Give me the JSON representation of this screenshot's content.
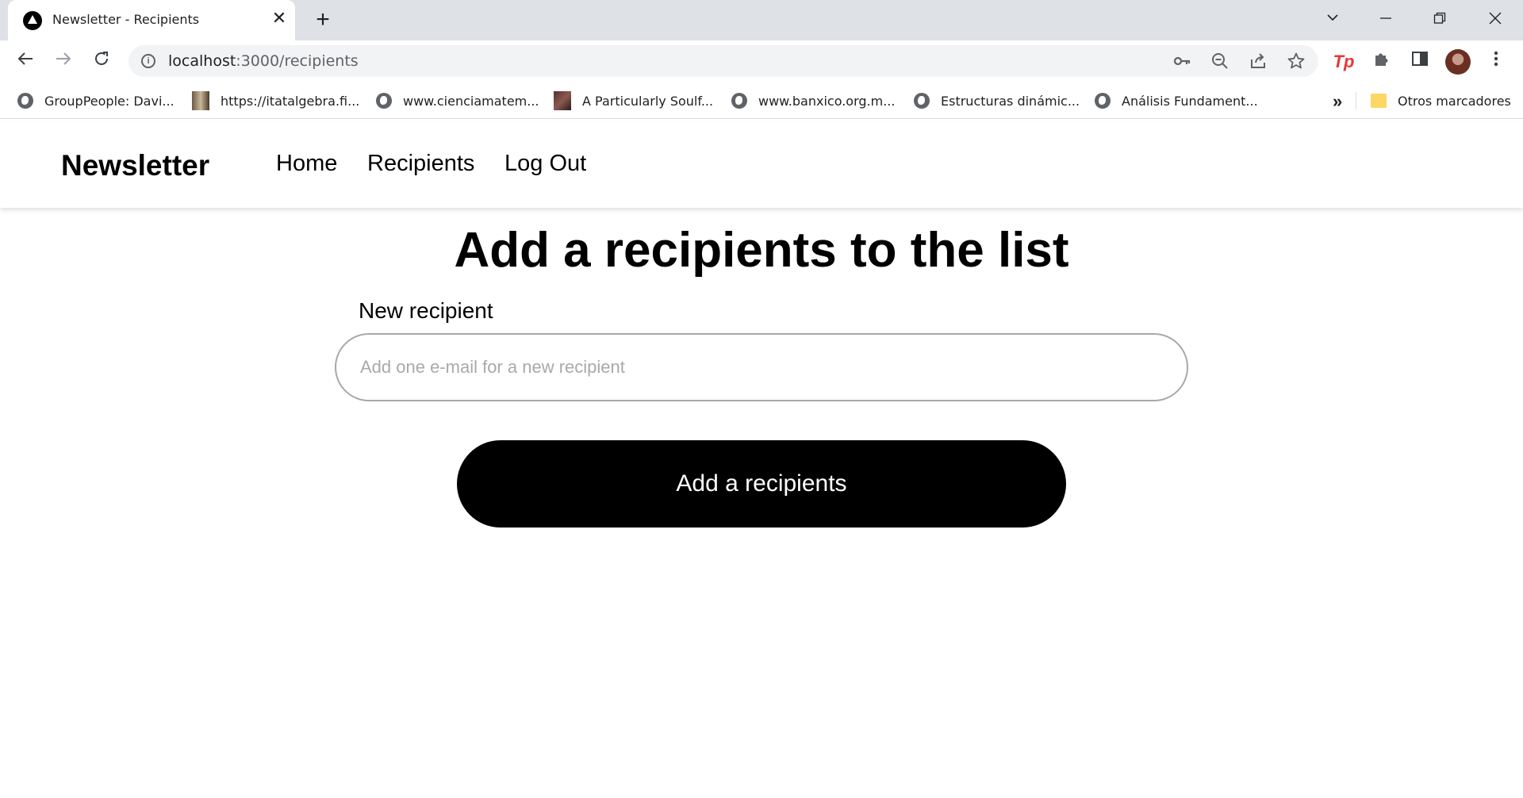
{
  "browser": {
    "tab_title": "Newsletter - Recipients",
    "tab_close": "✕",
    "new_tab": "+",
    "url_host": "localhost",
    "url_path": ":3000/recipients",
    "bookmarks": [
      {
        "label": "GroupPeople: Davi...",
        "icon": "globe-icon"
      },
      {
        "label": "https://itatalgebra.fi...",
        "icon": "thumbnail-icon"
      },
      {
        "label": "www.cienciamatem...",
        "icon": "globe-icon"
      },
      {
        "label": "A Particularly Soulf...",
        "icon": "thumbnail-icon"
      },
      {
        "label": "www.banxico.org.m...",
        "icon": "globe-icon"
      },
      {
        "label": "Estructuras dinámic...",
        "icon": "globe-icon"
      },
      {
        "label": "Análisis Fundament...",
        "icon": "globe-icon"
      }
    ],
    "bookmarks_more": "»",
    "other_bookmarks": "Otros marcadores"
  },
  "site": {
    "brand": "Newsletter",
    "nav": {
      "home": "Home",
      "recipients": "Recipients",
      "logout": "Log Out"
    }
  },
  "main": {
    "title": "Add a recipients to the list",
    "field_label": "New recipient",
    "input_value": "",
    "input_placeholder": "Add one e-mail for a new recipient",
    "submit_label": "Add a recipients"
  },
  "colors": {
    "button_bg": "#000000",
    "button_text": "#ffffff",
    "input_border": "#a8a8a8",
    "tp_icon": "#e53935"
  }
}
